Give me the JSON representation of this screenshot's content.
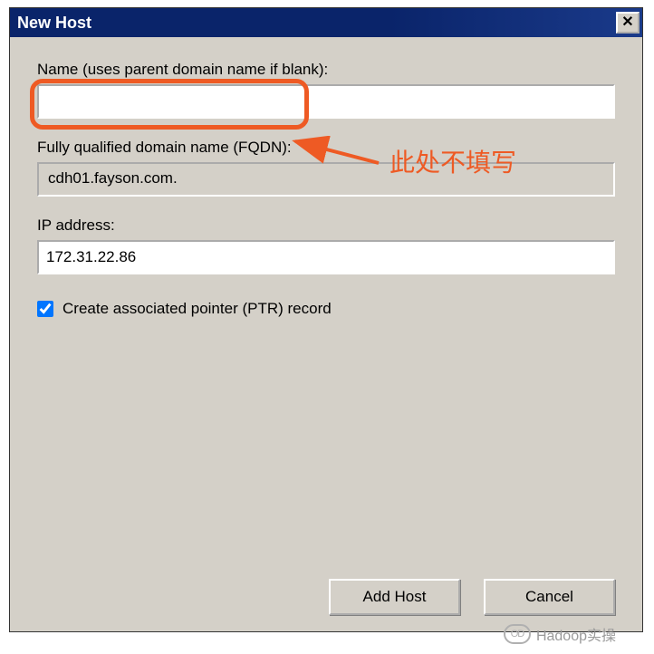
{
  "window": {
    "title": "New Host"
  },
  "fields": {
    "name": {
      "label": "Name (uses parent domain name if blank):",
      "value": ""
    },
    "fqdn": {
      "label": "Fully qualified domain name (FQDN):",
      "value": "cdh01.fayson.com."
    },
    "ip": {
      "label": "IP address:",
      "value": "172.31.22.86"
    },
    "ptr": {
      "checked": true,
      "label": "Create associated pointer (PTR) record"
    }
  },
  "buttons": {
    "add": "Add Host",
    "cancel": "Cancel"
  },
  "annotation": {
    "text": "此处不填写"
  },
  "watermark": {
    "text": "Hadoop实操"
  }
}
